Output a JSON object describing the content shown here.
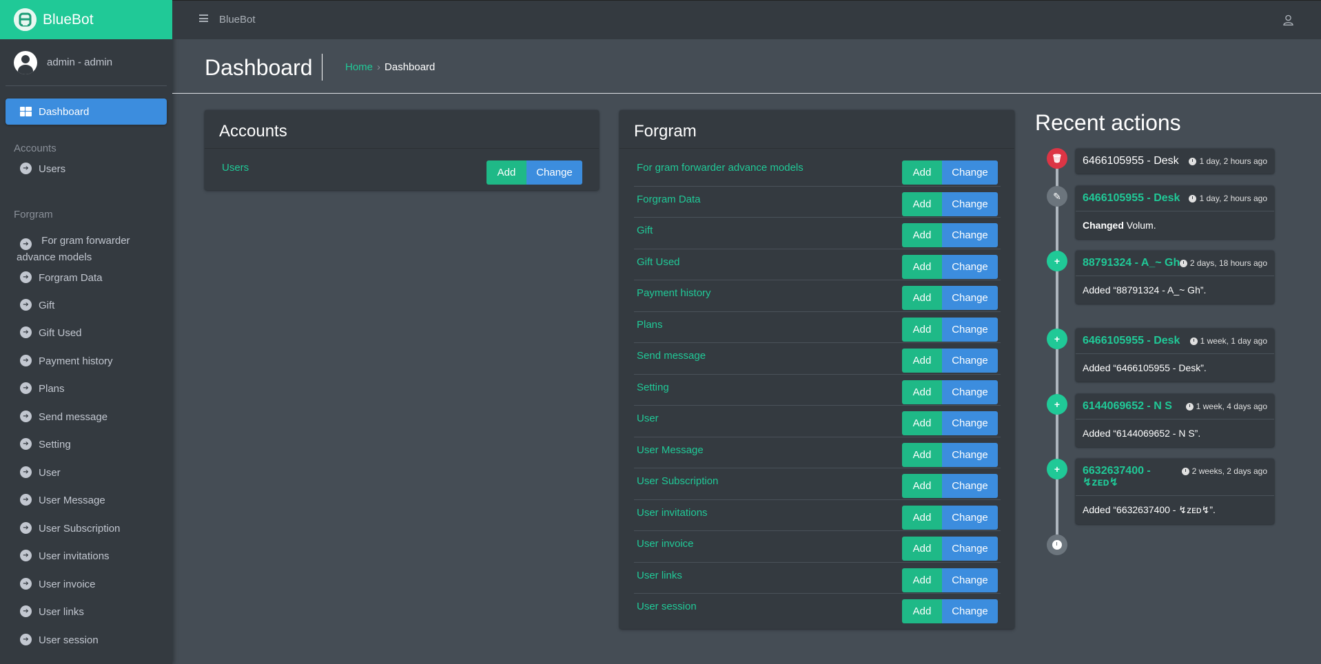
{
  "brand": {
    "name": "BlueBot"
  },
  "user": {
    "name": "admin - admin"
  },
  "topbar": {
    "title": "BlueBot"
  },
  "sidebar": {
    "active": "Dashboard",
    "sections": [
      {
        "header": "Accounts",
        "items": [
          "Users"
        ]
      },
      {
        "header": "Forgram",
        "items": [
          "For gram forwarder advance models",
          "Forgram Data",
          "Gift",
          "Gift Used",
          "Payment history",
          "Plans",
          "Send message",
          "Setting",
          "User",
          "User Message",
          "User Subscription",
          "User invitations",
          "User invoice",
          "User links",
          "User session"
        ]
      }
    ]
  },
  "header": {
    "title": "Dashboard",
    "breadcrumb": {
      "home": "Home",
      "sep": "›",
      "current": "Dashboard"
    }
  },
  "buttons": {
    "add": "Add",
    "change": "Change"
  },
  "apps": [
    {
      "title": "Accounts",
      "models": [
        "Users"
      ]
    },
    {
      "title": "Forgram",
      "models": [
        "For gram forwarder advance models",
        "Forgram Data",
        "Gift",
        "Gift Used",
        "Payment history",
        "Plans",
        "Send message",
        "Setting",
        "User",
        "User Message",
        "User Subscription",
        "User invitations",
        "User invoice",
        "User links",
        "User session"
      ]
    }
  ],
  "recent": {
    "title": "Recent actions",
    "items": [
      {
        "icon": "trash-icon",
        "color": "#dc3545",
        "title": "6466105955 - Desk",
        "link": false,
        "time": "1 day, 2 hours ago",
        "body_bold": "",
        "body": ""
      },
      {
        "icon": "edit-icon",
        "color": "#6c757d",
        "title": "6466105955 - Desk",
        "link": true,
        "time": "1 day, 2 hours ago",
        "body_bold": "Changed",
        "body": " Volum."
      },
      {
        "icon": "plus-circle-icon",
        "color": "#20c997",
        "title": "88791324 - A_~ Gh",
        "link": true,
        "time": "2 days, 18 hours ago",
        "body_bold": "",
        "body": "Added “88791324 - A_~ Gh”."
      },
      {
        "icon": "plus-circle-icon",
        "color": "#20c997",
        "title": "6466105955 - Desk",
        "link": true,
        "time": "1 week, 1 day ago",
        "body_bold": "",
        "body": "Added “6466105955 - Desk”."
      },
      {
        "icon": "plus-circle-icon",
        "color": "#20c997",
        "title": "6144069652 - N S",
        "link": true,
        "time": "1 week, 4 days ago",
        "body_bold": "",
        "body": "Added “6144069652 - N S”."
      },
      {
        "icon": "plus-circle-icon",
        "color": "#20c997",
        "title": "6632637400 - ↯ᴢᴇᴅ↯",
        "link": true,
        "time": "2 weeks, 2 days ago",
        "body_bold": "",
        "body": "Added “6632637400 - ↯ᴢᴇᴅ↯”."
      }
    ]
  }
}
